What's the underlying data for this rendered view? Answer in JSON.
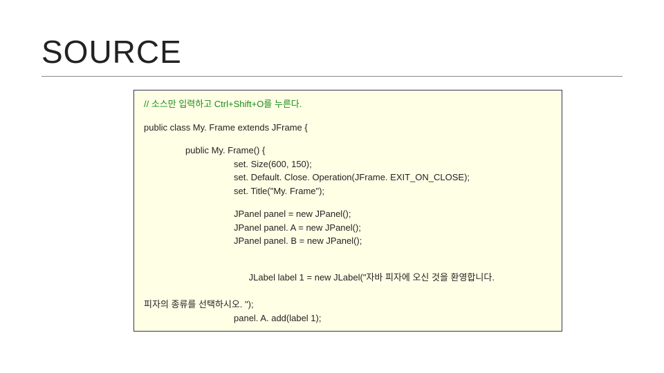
{
  "title": "SOURCE",
  "code": {
    "comment": "// 소스만 입력하고 Ctrl+Shift+O를 누른다.",
    "l_class": "public class My. Frame extends JFrame {",
    "l_ctor": "public My. Frame() {",
    "l_size": "set. Size(600, 150);",
    "l_close": "set. Default. Close. Operation(JFrame. EXIT_ON_CLOSE);",
    "l_title": "set. Title(\"My. Frame\");",
    "l_panel": "JPanel panel = new JPanel();",
    "l_panelA": "JPanel panel. A = new JPanel();",
    "l_panelB": "JPanel panel. B = new JPanel();",
    "l_label_pre": "JLabel label 1 = new JLabel(\"자바 피자에 오신 것을 환영합니다. ",
    "l_label_wrap": "피자의 종류를 선택하시오. \");",
    "l_add": "panel. A. add(label 1);"
  }
}
